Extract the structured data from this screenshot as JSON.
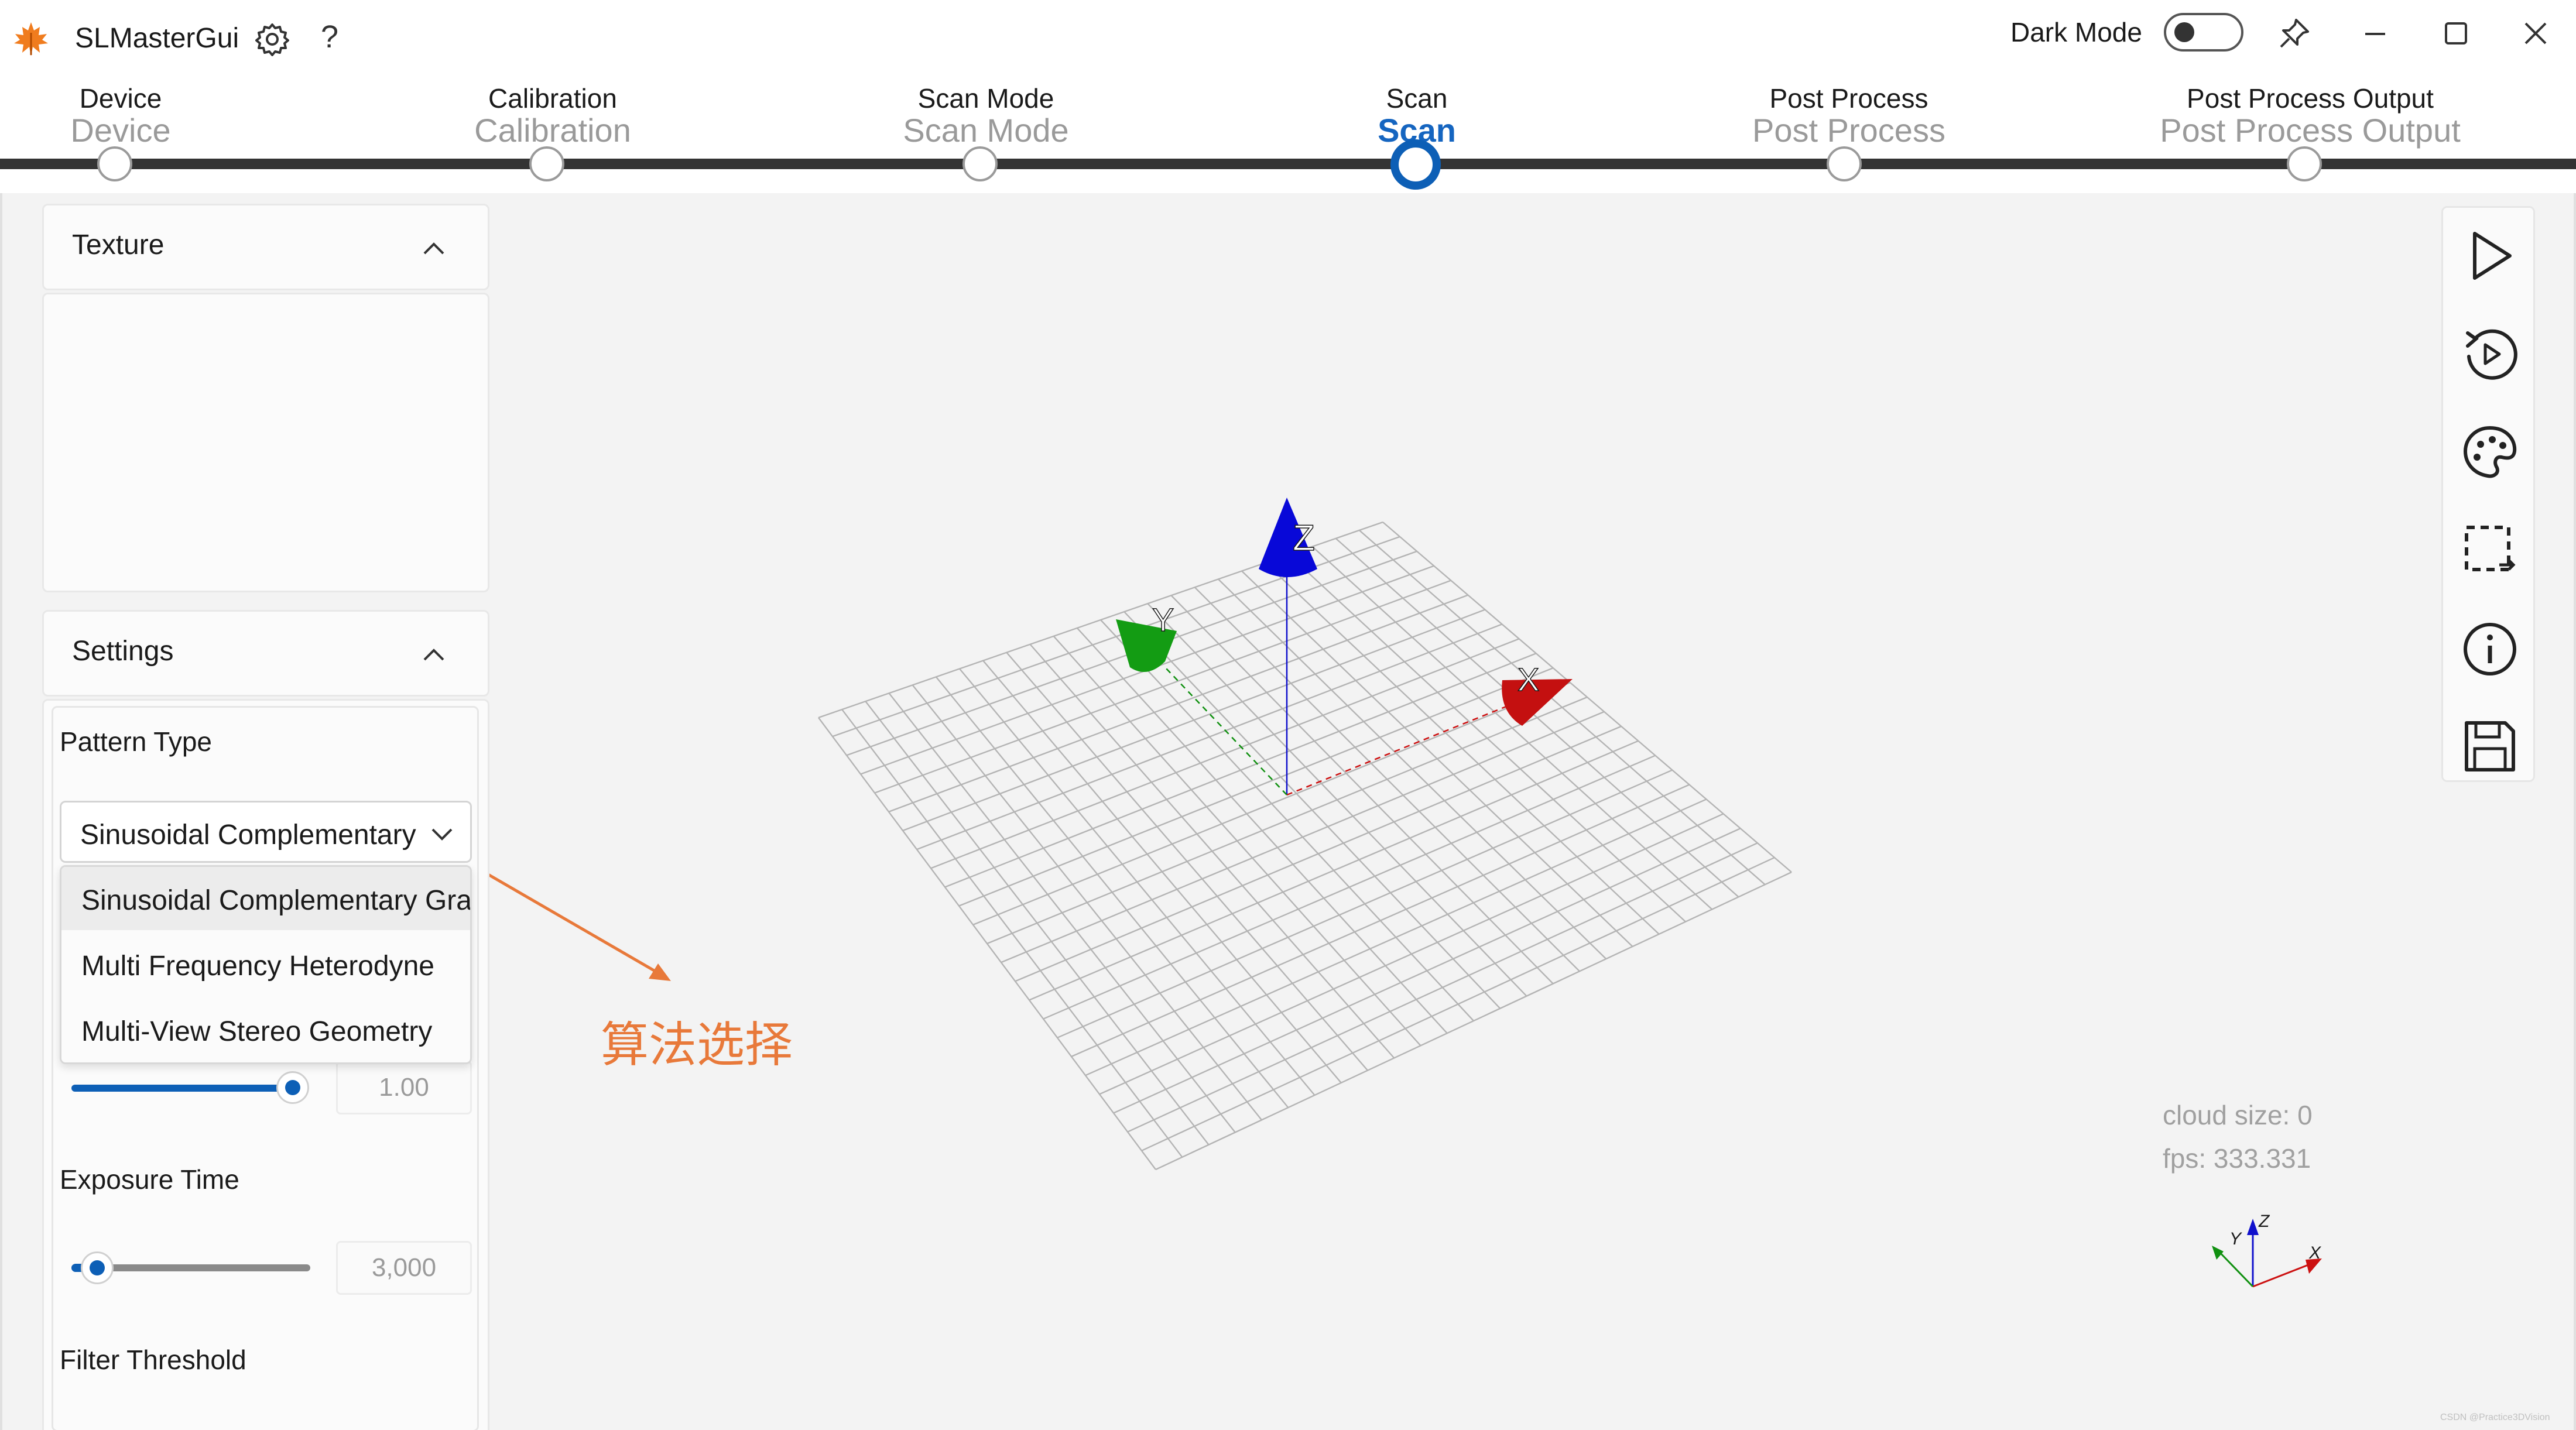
{
  "titlebar": {
    "app_title": "SLMasterGui",
    "help_glyph": "?",
    "dark_mode_label": "Dark Mode",
    "dark_mode_on": false,
    "icons": [
      "maple-leaf-logo-icon",
      "gear-icon",
      "help-icon",
      "toggle-switch",
      "pin-icon",
      "minimize-icon",
      "maximize-icon",
      "close-icon"
    ]
  },
  "stepper": {
    "steps": [
      {
        "title": "Device",
        "subtitle": "Device"
      },
      {
        "title": "Calibration",
        "subtitle": "Calibration"
      },
      {
        "title": "Scan Mode",
        "subtitle": "Scan Mode"
      },
      {
        "title": "Scan",
        "subtitle": "Scan"
      },
      {
        "title": "Post Process",
        "subtitle": "Post Process"
      },
      {
        "title": "Post Process Output",
        "subtitle": "Post Process Output"
      }
    ],
    "active_index": 3
  },
  "left_panel": {
    "texture_header": "Texture",
    "settings_header": "Settings",
    "pattern_type_label": "Pattern Type",
    "pattern_type_value": "Sinusoidal Complementary",
    "pattern_options": [
      "Sinusoidal Complementary Gray",
      "Multi Frequency Heterodyne",
      "Multi-View Stereo Geometry"
    ],
    "highlighted_option_index": 0,
    "first_slider_value": "1.00",
    "first_slider_fraction": 0.97,
    "exposure_label": "Exposure Time",
    "exposure_value": "3,000",
    "exposure_fraction": 0.05,
    "filter_label": "Filter Threshold"
  },
  "annotation": {
    "text": "算法选择",
    "color": "#e8793a"
  },
  "viewport": {
    "axis_labels": {
      "x": "X",
      "y": "Y",
      "z": "Z"
    },
    "axis_colors": {
      "x": "#cc1010",
      "y": "#109010",
      "z": "#1010cc"
    },
    "cloud_size": "cloud size: 0",
    "fps": "fps: 333.331"
  },
  "right_toolbar": {
    "icons": [
      "play-icon",
      "replay-icon",
      "palette-icon",
      "selection-icon",
      "info-icon",
      "save-icon"
    ]
  },
  "watermark": "CSDN @Practice3DVision",
  "colors": {
    "accent": "#0d5fb6",
    "background": "#f3f3f3",
    "panel": "#fbfbfb"
  }
}
